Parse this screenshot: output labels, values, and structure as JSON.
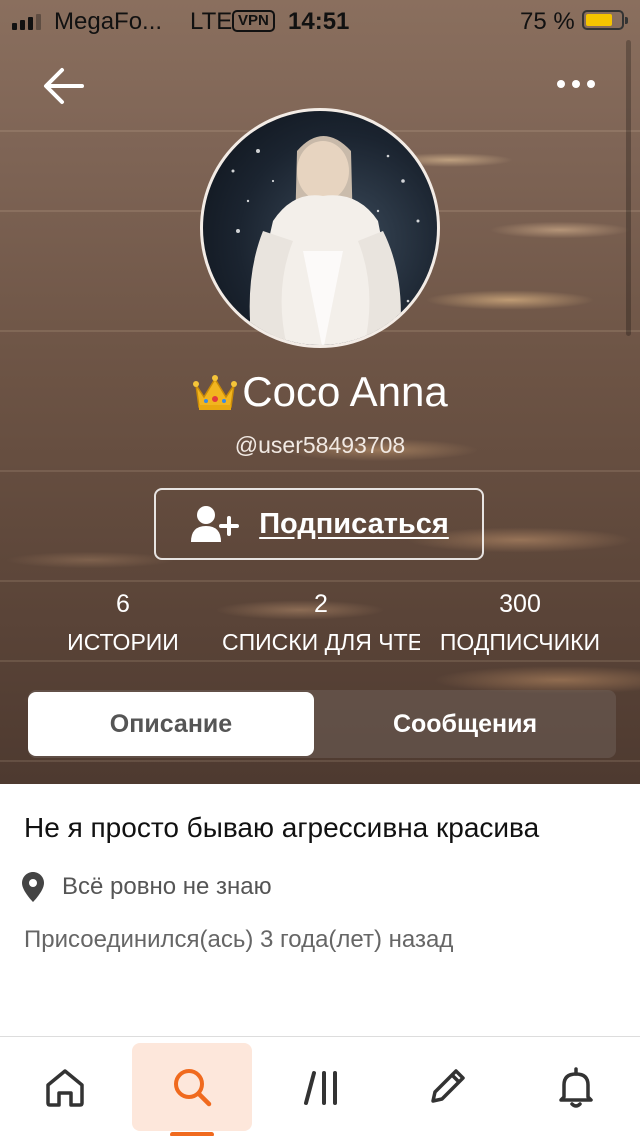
{
  "status_bar": {
    "carrier": "MegaFo...",
    "network": "LTE",
    "vpn": "VPN",
    "time": "14:51",
    "battery": "75 %",
    "battery_level": 0.75
  },
  "profile": {
    "display_name": "Coco Anna",
    "handle": "@user58493708",
    "follow_label": "Подписаться"
  },
  "stats": [
    {
      "value": "6",
      "label": "ИСТОРИИ"
    },
    {
      "value": "2",
      "label": "СПИСКИ ДЛЯ ЧТЕНИЯ"
    },
    {
      "value": "300",
      "label": "ПОДПИСЧИКИ"
    }
  ],
  "tabs": {
    "description": "Описание",
    "messages": "Сообщения"
  },
  "about": {
    "bio": "Не я просто бываю агрессивна красива",
    "location": "Всё ровно не знаю",
    "joined": "Присоединился(ась) 3 года(лет) назад"
  },
  "colors": {
    "accent": "#f06a1e",
    "accent_bg": "#fde7db",
    "battery": "#f5c400"
  },
  "icons": {
    "back": "arrow-left-icon",
    "more": "more-horizontal-icon",
    "follow": "add-user-icon",
    "location": "map-pin-icon",
    "home": "home-icon",
    "search": "search-icon",
    "library": "library-icon",
    "write": "pencil-icon",
    "notifications": "bell-icon"
  }
}
